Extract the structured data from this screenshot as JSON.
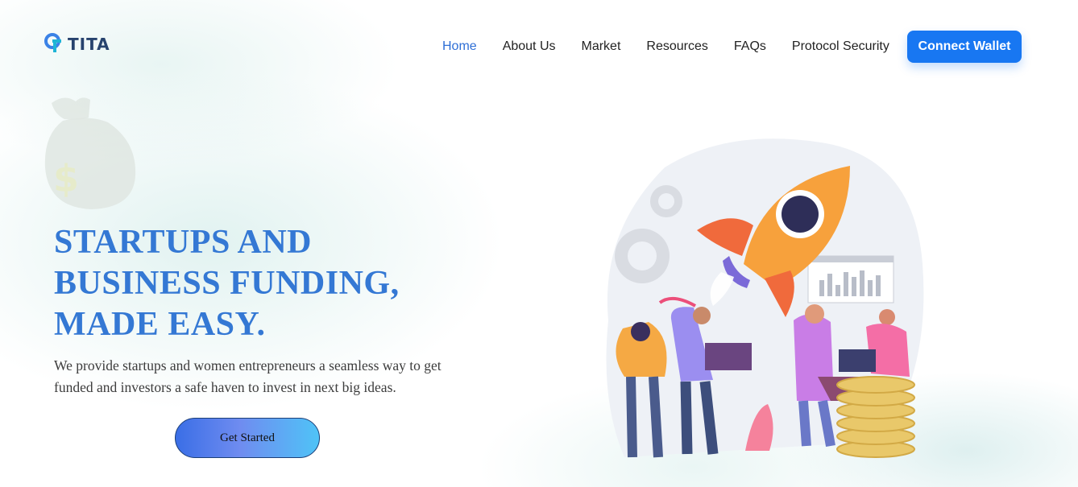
{
  "brand": {
    "name": "TITA"
  },
  "nav": {
    "items": [
      {
        "label": "Home",
        "active": true
      },
      {
        "label": "About Us"
      },
      {
        "label": "Market"
      },
      {
        "label": "Resources"
      },
      {
        "label": "FAQs"
      },
      {
        "label": "Protocol Security"
      }
    ],
    "cta_label": "Connect Wallet"
  },
  "hero": {
    "title_lines": [
      "STARTUPS AND",
      "BUSINESS FUNDING,",
      "MADE EASY."
    ],
    "subtitle": "We provide startups and women entrepreneurs a seamless way to get funded and investors a safe haven to invest in next big ideas.",
    "button_label": "Get Started"
  },
  "colors": {
    "accent": "#1877f2",
    "title": "#3478d4",
    "nav_active": "#2f6fd6"
  },
  "icons": {
    "logo": "tita-logo-icon",
    "decoration": "money-bag-icon",
    "illustration": "rocket-team-illustration"
  }
}
